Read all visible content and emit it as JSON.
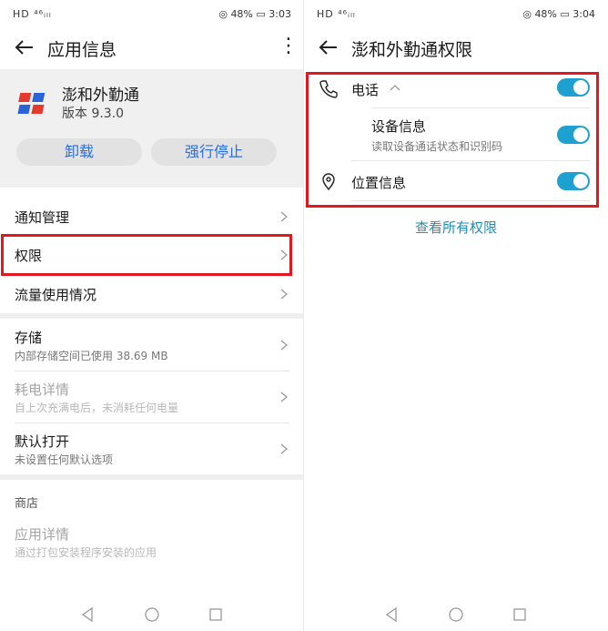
{
  "status_left": {
    "network": "HD ⁴⁶ᵢₗₗ",
    "wifi_icon": "wifi-icon",
    "app_icon": "app-mini-icon",
    "notif_icon": "bell-icon"
  },
  "status_right_left": {
    "battery": "48%",
    "time": "3:03"
  },
  "status_right_right": {
    "battery": "48%",
    "time": "3:04"
  },
  "left": {
    "title": "应用信息",
    "app_name": "澎和外勤通",
    "app_version": "版本 9.3.0",
    "uninstall_label": "卸载",
    "force_stop_label": "强行停止",
    "rows": {
      "notifications": "通知管理",
      "permissions": "权限",
      "data_usage": "流量使用情况",
      "storage": "存储",
      "storage_sub": "内部存储空间已使用 38.69 MB",
      "battery": "耗电详情",
      "battery_sub": "自上次充满电后，未消耗任何电量",
      "default_open": "默认打开",
      "default_open_sub": "未设置任何默认选项"
    },
    "store_section": "商店",
    "app_details": "应用详情",
    "app_details_sub": "通过打包安装程序安装的应用"
  },
  "right": {
    "title": "澎和外勤通权限",
    "phone_label": "电话",
    "device_info_label": "设备信息",
    "device_info_sub": "读取设备通话状态和识别码",
    "location_label": "位置信息",
    "view_all_label": "查看所有权限"
  },
  "toggles": {
    "phone": true,
    "device_info": true,
    "location": true
  },
  "colors": {
    "accent_blue": "#2b6de0",
    "toggle_on": "#1ea0d0",
    "highlight": "#e3171f",
    "link": "#1f8fb5"
  }
}
